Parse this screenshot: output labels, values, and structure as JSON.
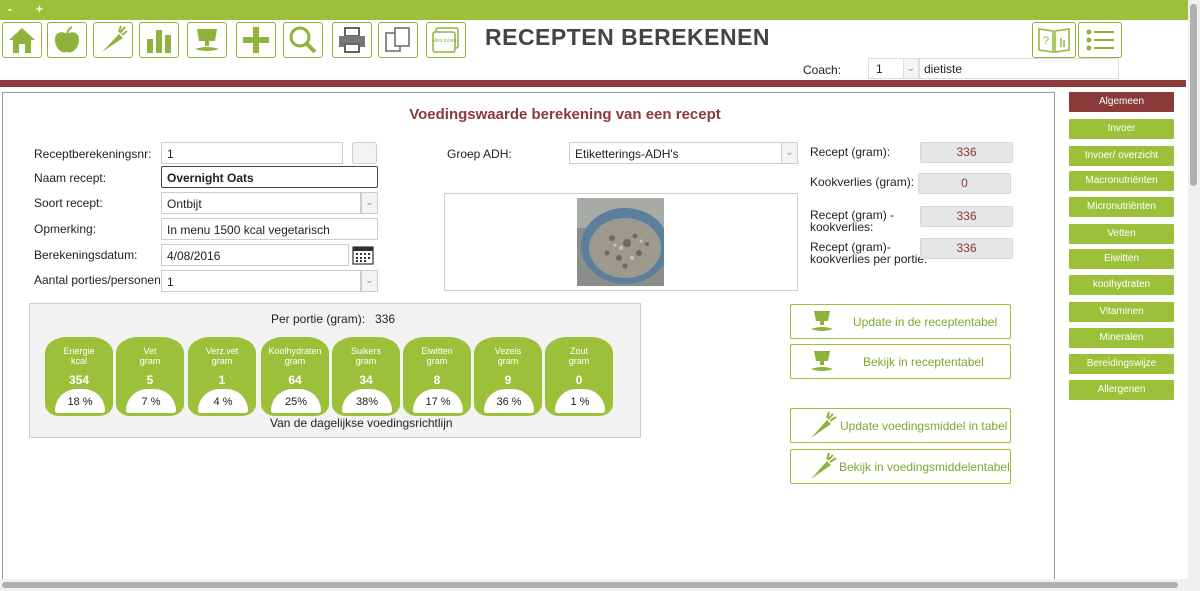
{
  "window": {
    "minimize": "-",
    "add": "+"
  },
  "toolbar": {
    "icons": [
      "home-icon",
      "apple-icon",
      "carrot-icon",
      "bar-chart-icon",
      "bowl-icon",
      "plus-icon",
      "magnifier-icon",
      "printer-icon",
      "copy-icon",
      "cards-icon"
    ],
    "cards_label": "Alles tonen"
  },
  "app_title": "RECEPTEN BEREKENEN",
  "coach": {
    "label": "Coach:",
    "number": "1",
    "name": "dietiste"
  },
  "heading": "Voedingswaarde berekening van een recept",
  "form": {
    "nr_label": "Receptberekeningsnr:",
    "nr_value": "1",
    "name_label": "Naam recept:",
    "name_value": "Overnight Oats",
    "type_label": "Soort recept:",
    "type_value": "Ontbijt",
    "remark_label": "Opmerking:",
    "remark_value": "In menu 1500 kcal vegetarisch",
    "date_label": "Berekeningsdatum:",
    "date_value": "4/08/2016",
    "portions_label": "Aantal porties/personen:",
    "portions_value": "1",
    "group_label": "Groep ADH:",
    "group_value": "Etiketterings-ADH's"
  },
  "stats": {
    "recipe_label": "Recept (gram):",
    "recipe_value": "336",
    "loss_label": "Kookverlies (gram):",
    "loss_value": "0",
    "minus_loss_label_1": "Recept (gram) -",
    "minus_loss_label_2": "kookverlies:",
    "minus_loss_value": "336",
    "per_portion_label_1": "Recept (gram)-",
    "per_portion_label_2": "kookverlies per portie:",
    "per_portion_value": "336"
  },
  "nutrition": {
    "per_portion_label": "Per portie (gram):",
    "per_portion_value": "336",
    "footer": "Van de dagelijkse voedingsrichtlijn",
    "items": [
      {
        "name1": "Energie",
        "name2": "kcal",
        "value": "354",
        "pct": "18 %"
      },
      {
        "name1": "Vet",
        "name2": "gram",
        "value": "5",
        "pct": "7  %"
      },
      {
        "name1": "Verz.vet",
        "name2": "gram",
        "value": "1",
        "pct": "4  %"
      },
      {
        "name1": "Koolhydraten",
        "name2": "gram",
        "value": "64",
        "pct": "25%"
      },
      {
        "name1": "Suikers",
        "name2": "gram",
        "value": "34",
        "pct": "38%"
      },
      {
        "name1": "Eiwitten",
        "name2": "gram",
        "value": "8",
        "pct": "17 %"
      },
      {
        "name1": "Vezels",
        "name2": "gram",
        "value": "9",
        "pct": "36 %"
      },
      {
        "name1": "Zout",
        "name2": "gram",
        "value": "0",
        "pct": "1  %"
      }
    ]
  },
  "actions": {
    "update_recipe": "Update in de receptentabel",
    "view_recipe": "Bekijk in receptentabel",
    "update_food": "Update voedingsmiddel in tabel",
    "view_food": "Bekijk in voedingsmiddelentabel"
  },
  "nav": [
    "Algemeen",
    "Invoer",
    "Invoer/ overzicht",
    "Macronutriënten",
    "Micronutriënten",
    "Vetten",
    "Eiwitten",
    "koolhydraten",
    "Vitaminen",
    "Mineralen",
    "Bereidingswijze",
    "Allergenen"
  ],
  "colors": {
    "green": "#9dc03b",
    "maroon": "#8b3a3a",
    "active_nav": "#8b3a3a"
  }
}
